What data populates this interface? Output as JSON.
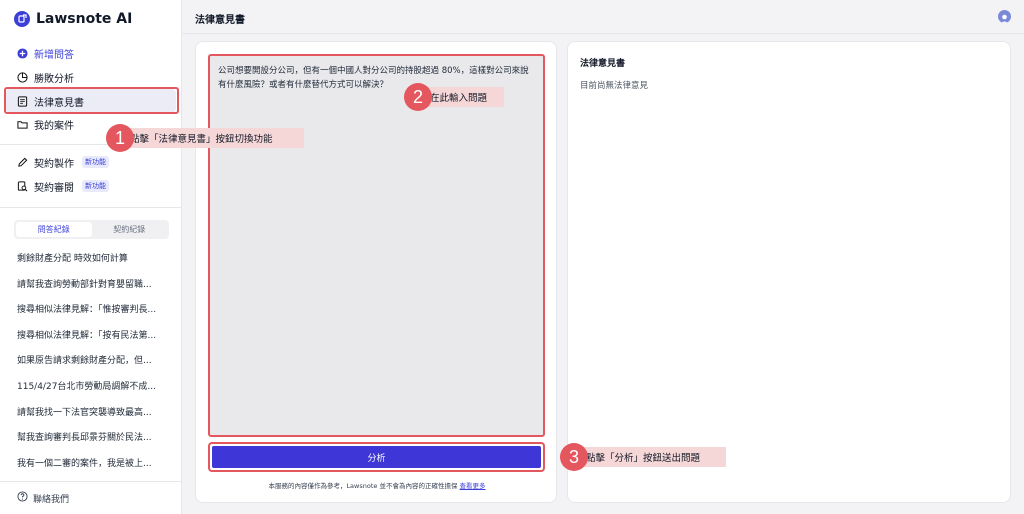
{
  "app": {
    "name": "Lawsnote AI"
  },
  "sidebar": {
    "nav": [
      {
        "label": "新增問答",
        "icon": "plus-circle-icon"
      },
      {
        "label": "勝敗分析",
        "icon": "pie-chart-icon"
      },
      {
        "label": "法律意見書",
        "icon": "document-icon"
      },
      {
        "label": "我的案件",
        "icon": "folder-icon"
      },
      {
        "label": "契約製作",
        "icon": "pen-icon",
        "badge": "新功能"
      },
      {
        "label": "契約審閱",
        "icon": "search-document-icon",
        "badge": "新功能"
      }
    ],
    "tabs": [
      "問答紀錄",
      "契約紀錄"
    ],
    "history": [
      "剩餘財產分配 時效如何計算",
      "請幫我查詢勞動部針對育嬰留職...",
      "搜尋相似法律見解：「惟按審判長...",
      "搜尋相似法律見解：「按有民法第...",
      "如果原告請求剩餘財產分配，但...",
      "115/4/27台北市勞動局調解不成...",
      "請幫我找一下法官突襲導致最高...",
      "幫我查詢審判長邱景芬關於民法...",
      "我有一個二審的案件，我是被上..."
    ],
    "contact": "聯絡我們"
  },
  "header": {
    "title": "法律意見書"
  },
  "editor": {
    "text": "公司想要開設分公司，但有一個中國人對分公司的持股超過 80%，這樣對公司來說有什麼風險？或者有什麼替代方式可以解決？",
    "button": "分析",
    "disclaimer": "本服務的內容僅作為參考，Lawsnote 並不會為內容的正確性擔保",
    "more": "查看更多"
  },
  "result": {
    "title": "法律意見書",
    "empty": "目前尚無法律意見"
  },
  "annotations": [
    {
      "num": "1",
      "text": "點擊「法律意見書」按鈕切換功能"
    },
    {
      "num": "2",
      "text": "在此輸入問題"
    },
    {
      "num": "3",
      "text": "點擊「分析」按鈕送出問題"
    }
  ],
  "colors": {
    "accent": "#3e36d6",
    "annotation": "#e5575e"
  }
}
